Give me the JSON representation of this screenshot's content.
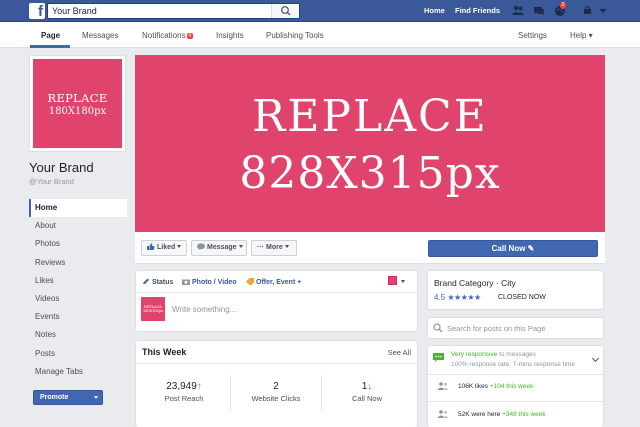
{
  "topbar": {
    "search_value": "Your Brand",
    "links": [
      "Home",
      "Find Friends"
    ],
    "notification_count": "2"
  },
  "pagenav": {
    "tabs": [
      "Page",
      "Messages",
      "Notifications",
      "Insights",
      "Publishing Tools"
    ],
    "notifications_badge": "4",
    "settings": "Settings",
    "help": "Help ▾"
  },
  "profile": {
    "placeholder_line1": "REPLACE",
    "placeholder_line2": "180X180px",
    "name": "Your Brand",
    "handle": "@Your Brand"
  },
  "leftnav": [
    "Home",
    "About",
    "Photos",
    "Reviews",
    "Likes",
    "Videos",
    "Events",
    "Notes",
    "Posts",
    "Manage Tabs"
  ],
  "promote_label": "Promote",
  "cover": {
    "line1": "REPLACE",
    "line2": "828X315px"
  },
  "actions": {
    "liked": "Liked",
    "message": "Message",
    "more": "More",
    "call_now": "Call Now ✎"
  },
  "composer": {
    "tab_status": "Status",
    "tab_photo": "Photo / Video",
    "tab_offer": "Offer, Event +",
    "avatar_text": "REPLACE 180X180px",
    "placeholder": "Write something..."
  },
  "this_week": {
    "title": "This Week",
    "see_all": "See All",
    "stats": [
      {
        "value": "23,949",
        "arrow": "↑",
        "label": "Post Reach"
      },
      {
        "value": "2",
        "arrow": "",
        "label": "Website Clicks"
      },
      {
        "value": "1",
        "arrow": "↓",
        "label": "Call Now"
      }
    ]
  },
  "about": {
    "category": "Brand Category · City",
    "rating": "4.5",
    "stars": "★★★★★",
    "status": "CLOSED NOW"
  },
  "page_search_placeholder": "Search for posts on this Page",
  "responsiveness": {
    "line1_green": "Very responsive",
    "line1_grey": "to messages",
    "line2": "100% response rate, 7-mins response time",
    "likes": "106K likes",
    "likes_delta": "+104 this week",
    "checkins": "52K were here",
    "checkins_delta": "+348 this week"
  },
  "colors": {
    "facebook_blue": "#3b5998",
    "button_blue": "#4267b2",
    "placeholder_pink": "#e0436b",
    "positive_green": "#42b72a",
    "negative_red": "#fa3e3e"
  }
}
